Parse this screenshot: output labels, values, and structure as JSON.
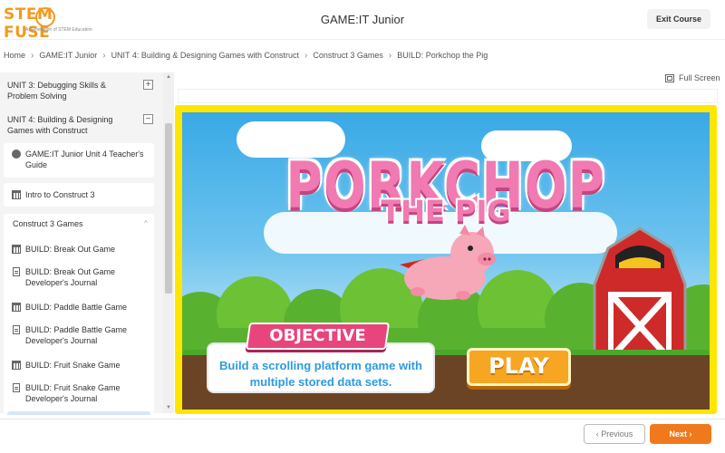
{
  "header": {
    "logo_text": "STEM FUSE",
    "logo_tagline": "A Generation of STEM Education",
    "title": "GAME:IT Junior",
    "exit_label": "Exit Course"
  },
  "breadcrumb": [
    "Home",
    "GAME:IT Junior",
    "UNIT 4: Building & Designing Games with Construct",
    "Construct 3 Games",
    "BUILD: Porkchop the Pig"
  ],
  "sidebar": {
    "unit3": {
      "label": "UNIT 3: Debugging Skills & Problem Solving",
      "toggle": "+"
    },
    "unit4": {
      "label": "UNIT 4: Building & Designing Games with Construct",
      "toggle": "−"
    },
    "teacher_guide": "GAME:IT Junior Unit 4 Teacher's Guide",
    "intro": "Intro to Construct 3",
    "section": {
      "label": "Construct 3 Games",
      "chevron": "^"
    },
    "items": [
      {
        "label": "BUILD: Break Out Game",
        "icon": "table-icon"
      },
      {
        "label": "BUILD: Break Out Game Developer's Journal",
        "icon": "document-icon"
      },
      {
        "label": "BUILD: Paddle Battle Game",
        "icon": "table-icon"
      },
      {
        "label": "BUILD: Paddle Battle Game Developer's Journal",
        "icon": "document-icon"
      },
      {
        "label": "BUILD: Fruit Snake Game",
        "icon": "table-icon"
      },
      {
        "label": "BUILD: Fruit Snake Game Developer's Journal",
        "icon": "document-icon"
      }
    ]
  },
  "main": {
    "fullscreen_label": "Full Screen",
    "game": {
      "title_line1": "PORKCHOP",
      "title_line2": "THE PIG",
      "objective_label": "OBJECTIVE",
      "objective_text": "Build a scrolling platform game with multiple stored data sets.",
      "play_label": "PLAY"
    }
  },
  "footer": {
    "previous_label": "‹ Previous",
    "next_label": "Next ›"
  },
  "colors": {
    "brand_orange": "#f39a1e",
    "next_button": "#f07a1b",
    "frame_yellow": "#ffe600",
    "pig_pink": "#f07ab1",
    "objective_blue": "#2b9be0"
  }
}
